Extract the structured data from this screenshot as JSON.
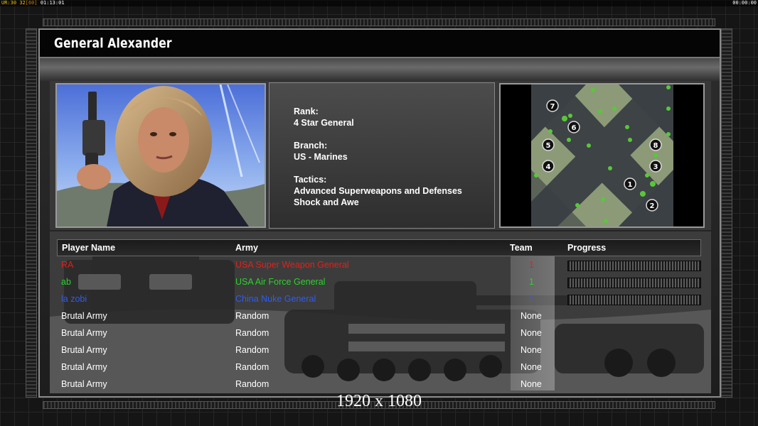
{
  "debug": {
    "fps_label": "UR:",
    "fps": "30",
    "fps_max": "32",
    "fps_cap": "[60]",
    "elapsed": "01:13:01",
    "clock": "00:00:00"
  },
  "general": {
    "name": "General Alexander",
    "rank_label": "Rank:",
    "rank": "4 Star General",
    "branch_label": "Branch:",
    "branch": "US - Marines",
    "tactics_label": "Tactics:",
    "tactics": [
      "Advanced Superweapons and Defenses",
      "Shock and Awe"
    ]
  },
  "minimap": {
    "start_positions": [
      "7",
      "6",
      "5",
      "4",
      "1",
      "2",
      "3",
      "8"
    ]
  },
  "table": {
    "headers": {
      "player": "Player Name",
      "army": "Army",
      "team": "Team",
      "progress": "Progress"
    },
    "rows": [
      {
        "player": "RA",
        "army": "USA Super Weapon General",
        "team": "1",
        "color": "#e0211c",
        "progress": 0
      },
      {
        "player": "ab",
        "army": "USA Air Force General",
        "team": "1",
        "color": "#2bd32b",
        "progress": 0
      },
      {
        "player": "la zobi",
        "army": "China Nuke General",
        "team": "1",
        "color": "#2f5cf2",
        "progress": 0
      },
      {
        "player": "Brutal Army",
        "army": "Random",
        "team": "None",
        "color": "#ffffff"
      },
      {
        "player": "Brutal Army",
        "army": "Random",
        "team": "None",
        "color": "#ffffff"
      },
      {
        "player": "Brutal Army",
        "army": "Random",
        "team": "None",
        "color": "#ffffff"
      },
      {
        "player": "Brutal Army",
        "army": "Random",
        "team": "None",
        "color": "#ffffff"
      },
      {
        "player": "Brutal Army",
        "army": "Random",
        "team": "None",
        "color": "#ffffff"
      }
    ]
  },
  "resolution_caption": "1920 x 1080"
}
